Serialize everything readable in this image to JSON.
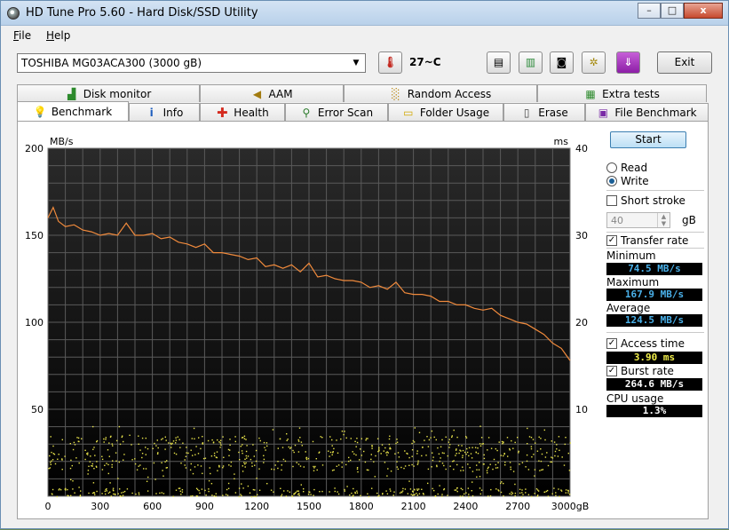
{
  "window": {
    "title": "HD Tune Pro 5.60 - Hard Disk/SSD Utility",
    "minimize": "–",
    "maximize": "□",
    "close": "x"
  },
  "menu": {
    "file_key": "F",
    "file_rest": "ile",
    "help_key": "H",
    "help_rest": "elp"
  },
  "toolbar": {
    "drive": "TOSHIBA MG03ACA300 (3000 gB)",
    "temperature": "27~C",
    "exit_label": "Exit"
  },
  "tabs_top": [
    {
      "label": "Disk monitor",
      "icon": "disk-monitor-icon"
    },
    {
      "label": "AAM",
      "icon": "speaker-icon"
    },
    {
      "label": "Random Access",
      "icon": "random-access-icon"
    },
    {
      "label": "Extra tests",
      "icon": "extra-tests-icon"
    }
  ],
  "tabs_bottom": [
    {
      "label": "Benchmark",
      "icon": "lightbulb-icon",
      "active": true
    },
    {
      "label": "Info",
      "icon": "info-icon"
    },
    {
      "label": "Health",
      "icon": "health-cross-icon"
    },
    {
      "label": "Error Scan",
      "icon": "magnifier-icon"
    },
    {
      "label": "Folder Usage",
      "icon": "folder-icon"
    },
    {
      "label": "Erase",
      "icon": "trash-icon"
    },
    {
      "label": "File Benchmark",
      "icon": "file-benchmark-icon"
    }
  ],
  "controls": {
    "start_label": "Start",
    "read_label": "Read",
    "write_label": "Write",
    "mode": "write",
    "short_stroke_label": "Short stroke",
    "short_stroke_checked": false,
    "short_stroke_value": "40",
    "short_stroke_unit": "gB",
    "transfer_rate_label": "Transfer rate",
    "transfer_rate_checked": true,
    "minimum_label": "Minimum",
    "minimum_value": "74.5 MB/s",
    "maximum_label": "Maximum",
    "maximum_value": "167.9 MB/s",
    "average_label": "Average",
    "average_value": "124.5 MB/s",
    "access_time_label": "Access time",
    "access_time_checked": true,
    "access_time_value": "3.90 ms",
    "burst_rate_label": "Burst rate",
    "burst_rate_checked": true,
    "burst_rate_value": "264.6 MB/s",
    "cpu_usage_label": "CPU usage",
    "cpu_usage_value": "1.3%"
  },
  "chart_data": {
    "type": "line",
    "ylabel_left": "MB/s",
    "ylabel_right": "ms",
    "x_unit": "gB",
    "xlim": [
      0,
      3000
    ],
    "ylim_left": [
      0,
      200
    ],
    "ylim_right": [
      0,
      40
    ],
    "x_ticks": [
      "0",
      "300",
      "600",
      "900",
      "1200",
      "1500",
      "1800",
      "2100",
      "2400",
      "2700",
      "3000gB"
    ],
    "y_ticks_left": [
      "200",
      "150",
      "100",
      "50"
    ],
    "y_ticks_right": [
      "40",
      "30",
      "20",
      "10"
    ],
    "grid": true,
    "colors": {
      "transfer": "#f08a3c",
      "access": "#e8e34a",
      "background": "#000000",
      "grid": "#5a5a5a"
    },
    "series": [
      {
        "x": [
          0,
          30,
          60,
          100,
          150,
          200,
          250,
          300,
          350,
          400,
          450,
          500,
          550,
          600,
          650,
          700,
          750,
          800,
          850,
          900,
          950,
          1000,
          1050,
          1100,
          1150,
          1200,
          1250,
          1300,
          1350,
          1400,
          1450,
          1500,
          1550,
          1600,
          1650,
          1700,
          1750,
          1800,
          1850,
          1900,
          1950,
          2000,
          2050,
          2100,
          2150,
          2200,
          2250,
          2300,
          2350,
          2400,
          2450,
          2500,
          2550,
          2600,
          2650,
          2700,
          2750,
          2800,
          2850,
          2900,
          2950,
          3000
        ],
        "values": [
          160,
          166,
          158,
          155,
          156,
          153,
          152,
          150,
          151,
          150,
          157,
          150,
          150,
          151,
          148,
          149,
          146,
          145,
          143,
          145,
          140,
          140,
          139,
          138,
          136,
          137,
          132,
          133,
          131,
          133,
          129,
          134,
          126,
          127,
          125,
          124,
          124,
          123,
          120,
          121,
          119,
          123,
          117,
          116,
          116,
          115,
          112,
          112,
          110,
          110,
          108,
          107,
          108,
          104,
          102,
          100,
          99,
          96,
          93,
          88,
          85,
          78
        ]
      }
    ],
    "access_scatter_range_ms": [
      0,
      14
    ]
  }
}
